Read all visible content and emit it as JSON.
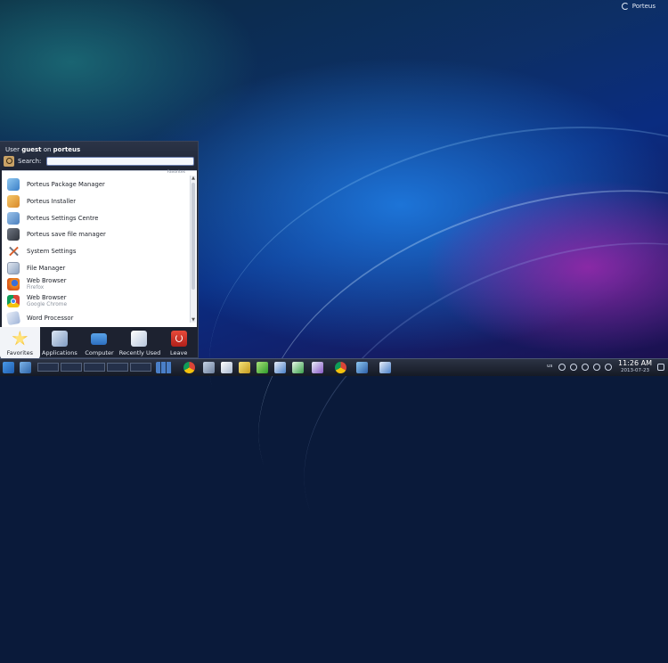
{
  "desktop": {
    "corner_label": "Porteus"
  },
  "launcher": {
    "user_prefix": "User",
    "user_name": "guest",
    "on_word": "on",
    "host_name": "porteus",
    "search_label": "Search:",
    "search_value": "",
    "list_caption": "Favorites",
    "favorites": [
      {
        "name": "Porteus Package Manager",
        "subtitle": "",
        "icon": "package-manager-icon"
      },
      {
        "name": "Porteus Installer",
        "subtitle": "",
        "icon": "installer-icon"
      },
      {
        "name": "Porteus Settings Centre",
        "subtitle": "",
        "icon": "settings-centre-icon"
      },
      {
        "name": "Porteus save file manager",
        "subtitle": "",
        "icon": "save-file-icon"
      },
      {
        "name": "System Settings",
        "subtitle": "",
        "icon": "system-settings-icon"
      },
      {
        "name": "File Manager",
        "subtitle": "",
        "icon": "file-manager-icon"
      },
      {
        "name": "Web Browser",
        "subtitle": "Firefox",
        "icon": "firefox-icon"
      },
      {
        "name": "Web Browser",
        "subtitle": "Google Chrome",
        "icon": "chrome-icon"
      },
      {
        "name": "Word Processor",
        "subtitle": "",
        "icon": "word-processor-icon"
      }
    ],
    "tabs": [
      {
        "label": "Favorites",
        "icon": "star-icon",
        "active": true
      },
      {
        "label": "Applications",
        "icon": "applications-icon",
        "active": false
      },
      {
        "label": "Computer",
        "icon": "computer-icon",
        "active": false
      },
      {
        "label": "Recently Used",
        "icon": "clock-icon",
        "active": false
      },
      {
        "label": "Leave",
        "icon": "power-icon",
        "active": false
      }
    ]
  },
  "taskbar": {
    "tray_language": "us",
    "time": "11:26 AM",
    "date": "2013-07-23",
    "colors": {
      "accent": "#2d6fc0",
      "panel": "#1d2230"
    }
  }
}
